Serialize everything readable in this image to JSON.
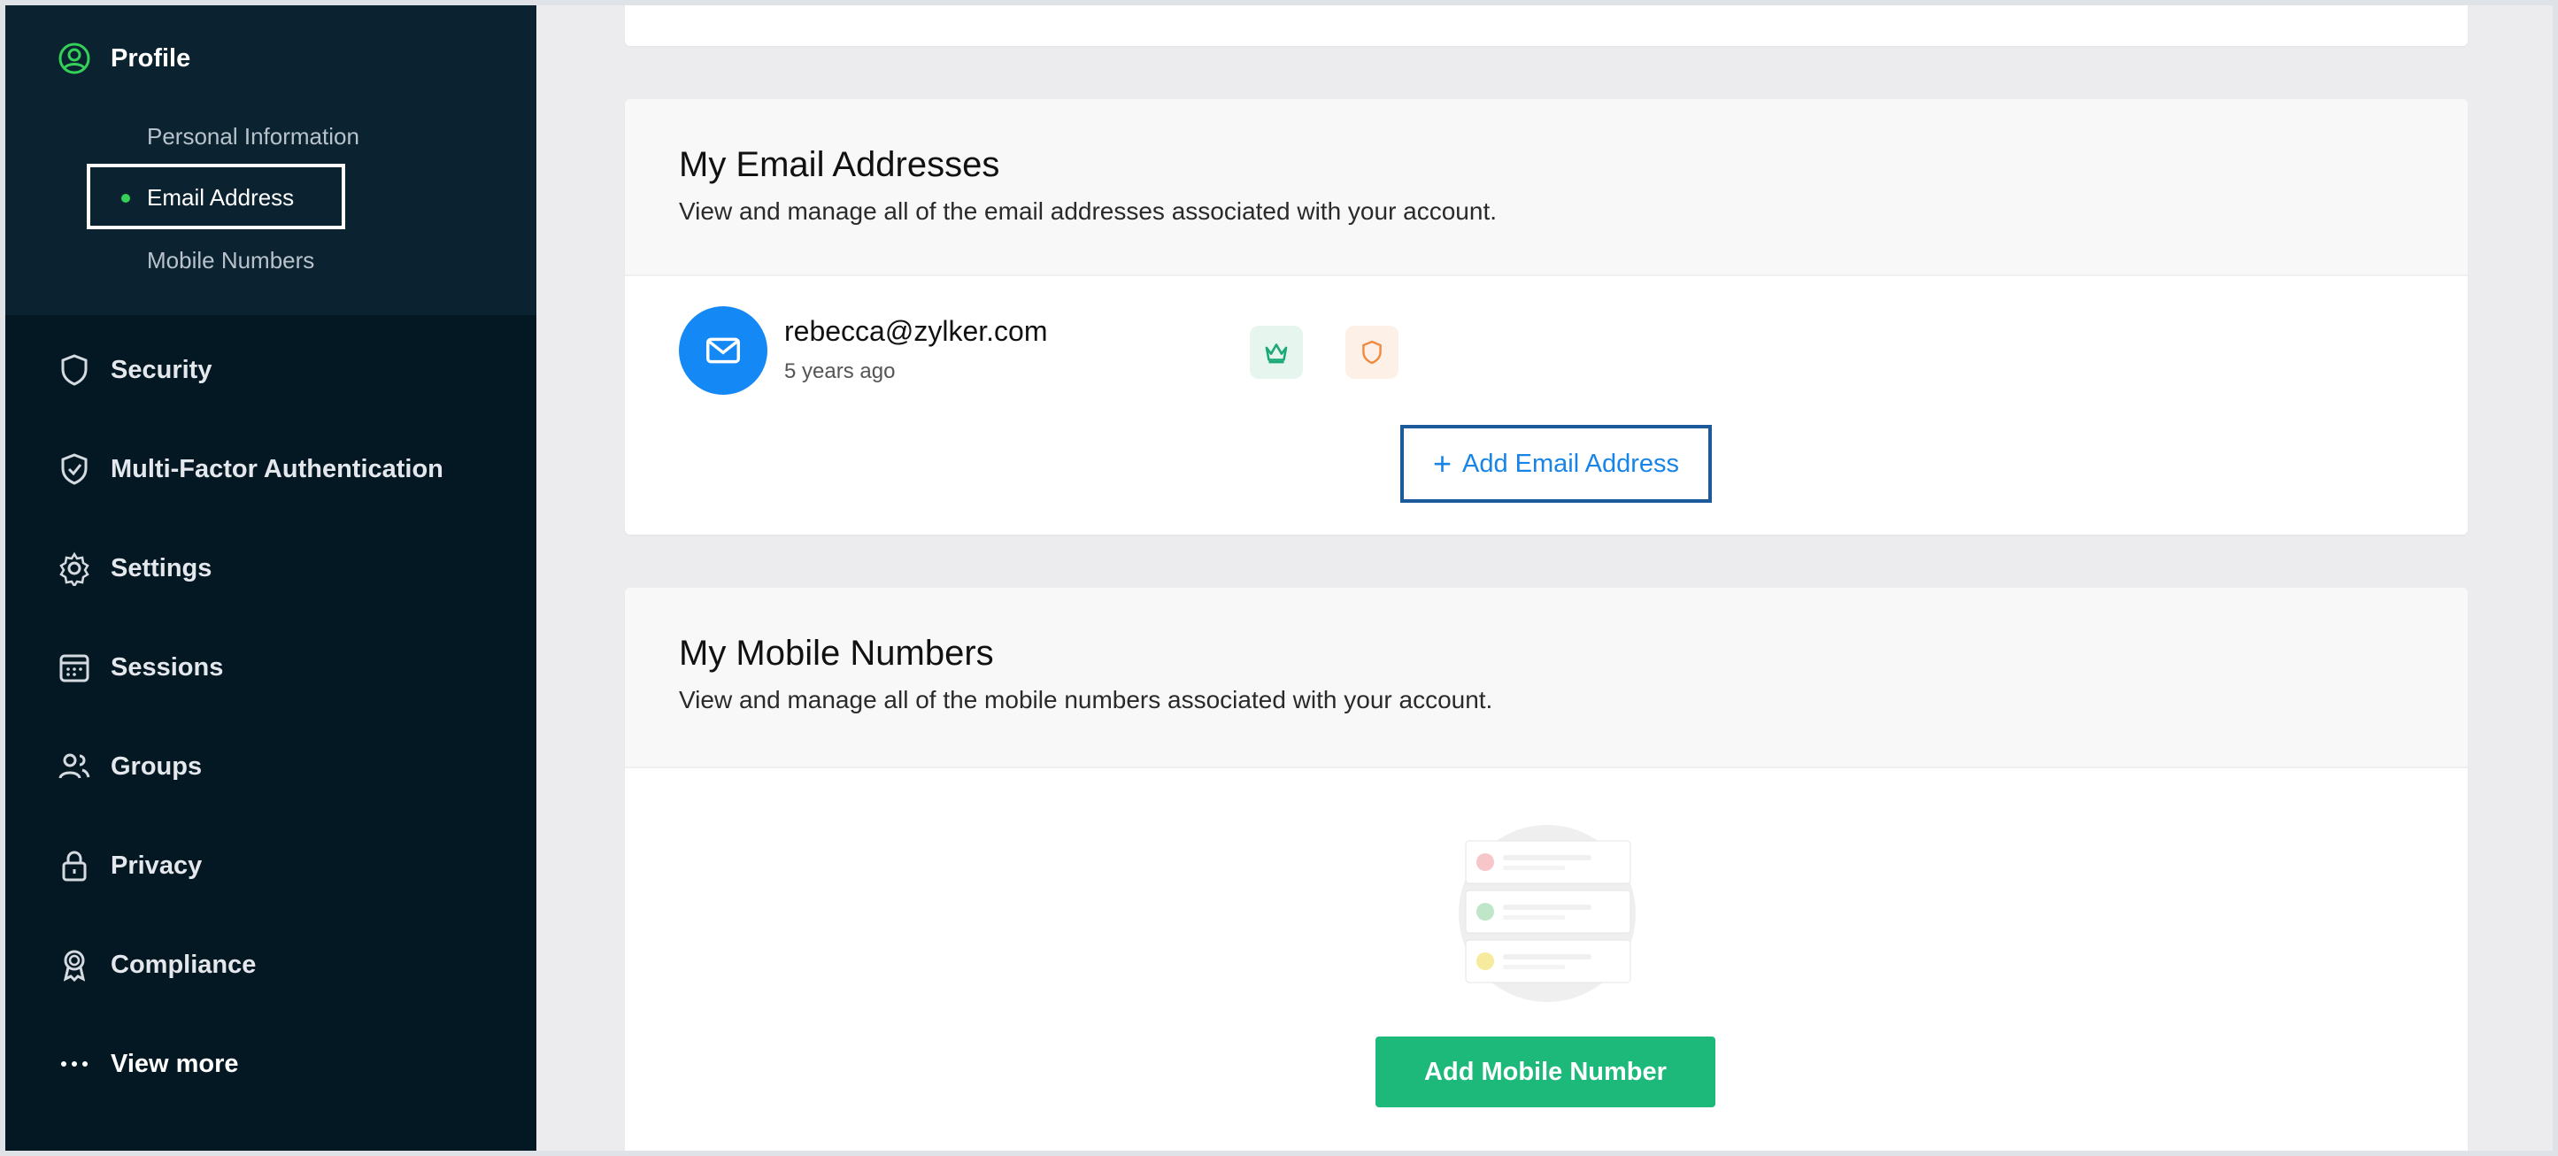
{
  "sidebar": {
    "profile_label": "Profile",
    "sub_items": [
      "Personal Information",
      "Email Address",
      "Mobile Numbers"
    ],
    "items": [
      {
        "label": "Security",
        "icon": "shield-icon"
      },
      {
        "label": "Multi-Factor Authentication",
        "icon": "shield-check-icon"
      },
      {
        "label": "Settings",
        "icon": "gear-icon"
      },
      {
        "label": "Sessions",
        "icon": "calendar-icon"
      },
      {
        "label": "Groups",
        "icon": "users-icon"
      },
      {
        "label": "Privacy",
        "icon": "lock-icon"
      },
      {
        "label": "Compliance",
        "icon": "award-icon"
      },
      {
        "label": "View more",
        "icon": "more-dots-icon"
      }
    ],
    "active_color": "#34d058"
  },
  "email_section": {
    "title": "My Email Addresses",
    "description": "View and manage all of the email addresses associated with your account.",
    "email": "rebecca@zylker.com",
    "added": "5 years ago",
    "primary_badge_icon": "crown-icon",
    "verified_badge_icon": "shield-icon",
    "add_button": "Add Email Address"
  },
  "mobile_section": {
    "title": "My Mobile Numbers",
    "description": "View and manage all of the mobile numbers associated with your account.",
    "add_button": "Add Mobile Number"
  },
  "colors": {
    "sidebar_bg": "#041824",
    "accent_blue": "#1784e8",
    "accent_green": "#1db97b"
  }
}
